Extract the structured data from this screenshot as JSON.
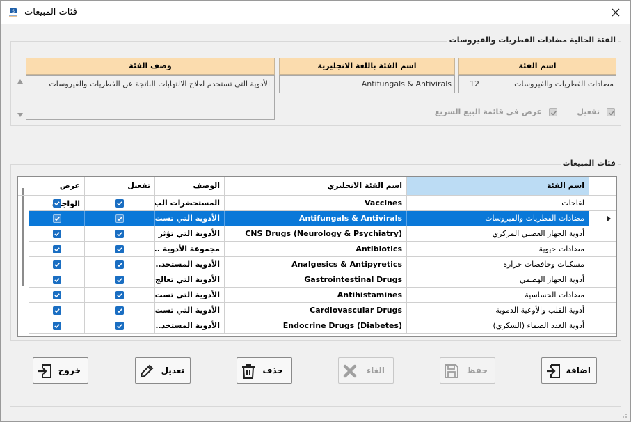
{
  "window": {
    "title": "فئات المبيعات"
  },
  "current": {
    "group_title": "الفئة الحالية مضادات الفطريات والفيروسات",
    "name_header": "اسم الفئة",
    "id_value": "12",
    "name_value": "مضادات الفطريات والفيروسات",
    "en_header": "اسم الفئة باللغة الانجليزية",
    "en_value": "Antifungals & Antivirals",
    "desc_header": "وصف الفئة",
    "desc_value": "الأدوية التي تستخدم لعلاج الالتهابات الناتجة عن الفطريات والفيروسات",
    "active_label": "تفعيل",
    "quick_sale_label": "عرض في قائمة البيع السريع",
    "active_checked": true,
    "quick_sale_checked": true
  },
  "list": {
    "group_title": "فئات المبيعات",
    "columns": {
      "name": "اسم الفئة",
      "en": "اسم الفئة الانجليزي",
      "desc": "الوصف",
      "active": "تفعيل",
      "frontend": "عرض الواجهة"
    },
    "rows": [
      {
        "name": "لقاحات",
        "en": "Vaccines",
        "desc": "المستحضرات الب...",
        "active": true,
        "frontend": true
      },
      {
        "name": "مضادات الفطريات والفيروسات",
        "en": "Antifungals & Antivirals",
        "desc": "الأدوية التي تست...",
        "active": true,
        "frontend": true
      },
      {
        "name": "أدوية الجهاز العصبي المركزي",
        "en": "CNS Drugs (Neurology & Psychiatry)",
        "desc": "الأدوية التي تؤثر ...",
        "active": true,
        "frontend": true
      },
      {
        "name": "مضادات حيوية",
        "en": "Antibiotics",
        "desc": "مجموعة الأدوية ...",
        "active": true,
        "frontend": true
      },
      {
        "name": "مسكنات وخافضات حرارة",
        "en": "Analgesics & Antipyretics",
        "desc": "الأدوية المستخد...",
        "active": true,
        "frontend": true
      },
      {
        "name": "أدوية الجهاز الهضمي",
        "en": "Gastrointestinal Drugs",
        "desc": "الأدوية التي تعالج...",
        "active": true,
        "frontend": true
      },
      {
        "name": "مضادات الحساسية",
        "en": "Antihistamines",
        "desc": "الأدوية التي تست...",
        "active": true,
        "frontend": true
      },
      {
        "name": "أدوية القلب والأوعية الدموية",
        "en": "Cardiovascular Drugs",
        "desc": "الأدوية التي تست...",
        "active": true,
        "frontend": true
      },
      {
        "name": "أدوية الغدد الصماء (السكري)",
        "en": "Endocrine Drugs (Diabetes)",
        "desc": "الأدوية المستخد...",
        "active": true,
        "frontend": true
      }
    ],
    "selected_index": 1
  },
  "buttons": {
    "add": "اضافة",
    "save": "حفظ",
    "cancel": "الغاء",
    "delete": "حذف",
    "edit": "تعديل",
    "exit": "خروج"
  },
  "colors": {
    "header_bg": "#fbdcae",
    "selection": "#0a78d8",
    "grid_header_selected": "#bcdcf4",
    "checkbox": "#1a6ec2"
  }
}
